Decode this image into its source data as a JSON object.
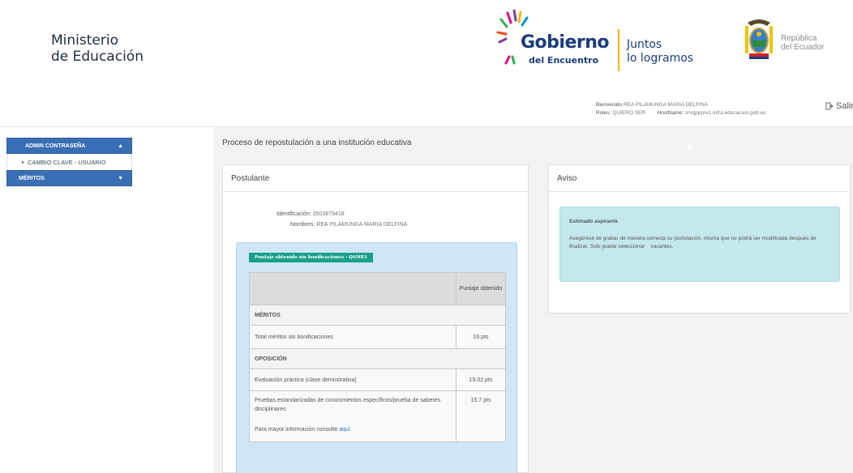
{
  "header": {
    "ministry_line1": "Ministerio",
    "ministry_line2": "de Educación",
    "gobierno": "Gobierno",
    "gobierno_sub": "del Encuentro",
    "juntos_line1": "Juntos",
    "juntos_line2": "lo logramos",
    "republica_line1": "República",
    "republica_line2": "del Ecuador"
  },
  "user": {
    "welcome_label": "Bienvenido",
    "name": "REA PILAMUNGA MARIA DELFINA",
    "roles_label": "Roles:",
    "roles": "QUIERO SER",
    "hostname_label": "HostName:",
    "hostname": "srvqpppre1.infra.educacion.gob.ec",
    "logout": "Salir"
  },
  "sidebar": {
    "items": [
      {
        "label": "ADMIN CONTRASEÑA",
        "icon": "caret-up-icon"
      },
      {
        "label": "CAMBIO CLAVE - USUARIO",
        "icon": "bullet-icon"
      },
      {
        "label": "MÉRITOS",
        "icon": "caret-down-icon"
      }
    ]
  },
  "main": {
    "title": "Proceso de repostulación a una institución educativa"
  },
  "postulante": {
    "heading": "Postulante",
    "id_label": "Identificación:",
    "id_value": "0503879418",
    "name_label": "Nombres:",
    "name_value": "REA PILAMUNGA MARIA DELFINA",
    "badge": "Puntaje obtenido sin bonificaciones - QSME1",
    "table": {
      "col_header": "Puntaje obtenido",
      "section_meritos": "MÉRITOS",
      "section_oposicion": "OPOSICIÓN",
      "rows": [
        {
          "label": "Total méritos sin bonificaciones",
          "value": "16 pts"
        },
        {
          "label": "Evaluación práctica (clase demostrativa)",
          "value": "19.02 pts"
        },
        {
          "label": "Pruebas estandarizadas de conocimientos específicos/prueba de saberes disciplinares",
          "value": "15.7 pts"
        }
      ],
      "more_info": "Para mayor información consulte",
      "more_link": "aquí"
    }
  },
  "aviso": {
    "heading": "Aviso",
    "title": "Estimado aspirante",
    "body_part1": "Asegúrese de grabar de manera correcta su postulación, misma que no podrá ser modificada después de finalizar. Solo puede seleccionar",
    "body_part2": "vacantes."
  },
  "colors": {
    "menu_blue": "#3a6fb5",
    "badge_green": "#1aa08a",
    "score_bg": "#cfe5f8",
    "aviso_bg": "#c5e8ec"
  }
}
